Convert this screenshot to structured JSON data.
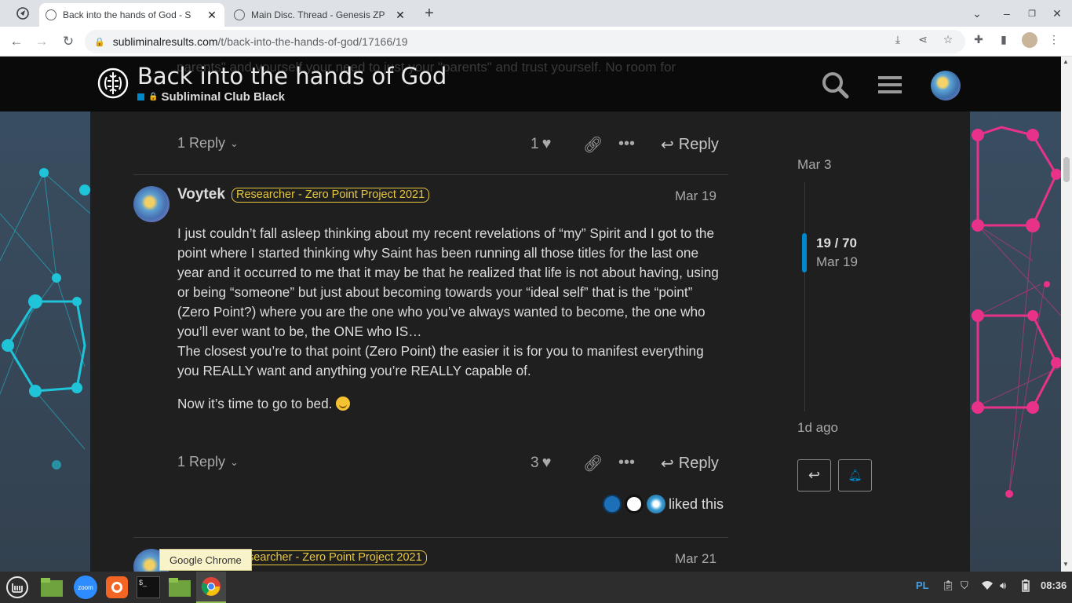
{
  "browser": {
    "tabs": [
      {
        "label": "Back into the hands of God - S",
        "active": true
      },
      {
        "label": "Main Disc. Thread - Genesis ZP",
        "active": false
      }
    ],
    "new_tab": "+",
    "url_host": "subliminalresults.com",
    "url_path": "/t/back-into-the-hands-of-god/17166/19"
  },
  "header": {
    "ghost_text": "parents\" and yourself your need to just your \"parents\" and trust yourself. No room for",
    "title": "Back into the hands of God",
    "category": "Subliminal Club Black"
  },
  "previous_post": {
    "replies": "1 Reply",
    "likes": "1",
    "reply_label": "Reply"
  },
  "post": {
    "username": "Voytek",
    "flair": "Researcher - Zero Point Project 2021",
    "date": "Mar 19",
    "paragraph1": "I just couldn’t fall asleep thinking about my recent revelations of “my” Spirit and I got to the point where I started thinking why Saint has been running all those titles for the last one year and it occurred to me that it may be that he realized that life is not about having, using or being “someone” but just about becoming towards your “ideal self” that is the “point” (Zero Point?) where you are the one who you’ve always wanted to become, the one who you’ll ever want to be, the ONE who IS…",
    "paragraph1b": "The closest you’re to that point (Zero Point) the easier it is for you to manifest everything you REALLY want and anything you’re REALLY capable of.",
    "paragraph2": "Now it’s time to go to bed.",
    "replies": "1 Reply",
    "likes": "3",
    "reply_label": "Reply",
    "liked_text": "liked this"
  },
  "next_post": {
    "flair_visible": "searcher - Zero Point Project 2021",
    "date": "Mar 21"
  },
  "timeline": {
    "start": "Mar 3",
    "position": "19 / 70",
    "position_date": "Mar 19",
    "end": "1d ago"
  },
  "tooltip": "Google Chrome",
  "taskbar": {
    "zoom_label": "zoom",
    "keyboard": "PL",
    "clock": "08:36"
  },
  "colors": {
    "accent": "#0088cc",
    "flair": "#e7c73c",
    "background": "#1f1f1f",
    "header": "#0a0a0a"
  }
}
